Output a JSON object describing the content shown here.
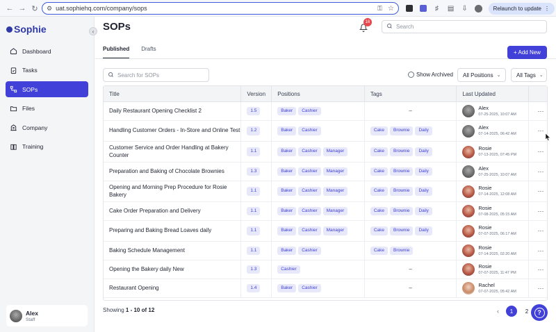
{
  "browser": {
    "url": "uat.sophiehq.com/company/sops",
    "relaunch_label": "Relaunch to update"
  },
  "brand": {
    "name": "Sophie",
    "accent": "#4140d8"
  },
  "sidebar": {
    "items": [
      {
        "label": "Dashboard",
        "icon": "home-icon",
        "active": false
      },
      {
        "label": "Tasks",
        "icon": "clipboard-check-icon",
        "active": false
      },
      {
        "label": "SOPs",
        "icon": "flow-icon",
        "active": true
      },
      {
        "label": "Files",
        "icon": "folder-icon",
        "active": false
      },
      {
        "label": "Company",
        "icon": "building-icon",
        "active": false
      },
      {
        "label": "Training",
        "icon": "book-icon",
        "active": false
      }
    ],
    "user": {
      "name": "Alex",
      "role": "Staff"
    }
  },
  "header": {
    "title": "SOPs",
    "notification_count": "16",
    "search_placeholder": "Search"
  },
  "tabs": [
    {
      "label": "Published",
      "active": true
    },
    {
      "label": "Drafts",
      "active": false
    }
  ],
  "toolbar": {
    "add_new_label": "+ Add New",
    "search_placeholder": "Search for SOPs",
    "show_archived_label": "Show Archived",
    "positions_filter": "All Positions",
    "tags_filter": "All Tags"
  },
  "table": {
    "columns": [
      "Title",
      "Version",
      "Positions",
      "Tags",
      "Last Updated"
    ],
    "rows": [
      {
        "title": "Daily Restaurant Opening Checklist 2",
        "version": "1.5",
        "positions": [
          "Baker",
          "Cashier"
        ],
        "tags": [],
        "user": "Alex",
        "date": "07-25-2025, 10:07 AM",
        "avatar": "alex"
      },
      {
        "title": "Handling Customer Orders - In-Store and Online Test",
        "version": "1.2",
        "positions": [
          "Baker",
          "Cashier"
        ],
        "tags": [
          "Cake",
          "Brownie",
          "Daily"
        ],
        "user": "Alex",
        "date": "07-14-2025, 06:42 AM",
        "avatar": "alex"
      },
      {
        "title": "Customer Service and Order Handling at Bakery Counter",
        "version": "1.1",
        "positions": [
          "Baker",
          "Cashier",
          "Manager"
        ],
        "tags": [
          "Cake",
          "Brownie",
          "Daily"
        ],
        "user": "Rosie",
        "date": "07-13-2025, 07:45 PM",
        "avatar": "rosie"
      },
      {
        "title": "Preparation and Baking of Chocolate Brownies",
        "version": "1.3",
        "positions": [
          "Baker",
          "Cashier",
          "Manager"
        ],
        "tags": [
          "Cake",
          "Brownie",
          "Daily"
        ],
        "user": "Alex",
        "date": "07-25-2025, 10:07 AM",
        "avatar": "alex"
      },
      {
        "title": "Opening and Morning Prep Procedure for Rosie Bakery",
        "version": "1.1",
        "positions": [
          "Baker",
          "Cashier",
          "Manager"
        ],
        "tags": [
          "Cake",
          "Brownie",
          "Daily"
        ],
        "user": "Rosie",
        "date": "07-14-2025, 12:08 AM",
        "avatar": "rosie"
      },
      {
        "title": "Cake Order Preparation and Delivery",
        "version": "1.1",
        "positions": [
          "Baker",
          "Cashier",
          "Manager"
        ],
        "tags": [
          "Cake",
          "Brownie",
          "Daily"
        ],
        "user": "Rosie",
        "date": "07-08-2025, 05:15 AM",
        "avatar": "rosie"
      },
      {
        "title": "Preparing and Baking Bread Loaves daily",
        "version": "1.1",
        "positions": [
          "Baker",
          "Cashier",
          "Manager"
        ],
        "tags": [
          "Cake",
          "Brownie",
          "Daily"
        ],
        "user": "Rosie",
        "date": "07-07-2025, 06:17 AM",
        "avatar": "rosie"
      },
      {
        "title": "Baking Schedule Management",
        "version": "1.1",
        "positions": [
          "Baker",
          "Cashier"
        ],
        "tags": [
          "Cake",
          "Brownie"
        ],
        "user": "Rosie",
        "date": "07-14-2025, 02:20 AM",
        "avatar": "rosie"
      },
      {
        "title": "Opening the Bakery daily New",
        "version": "1.3",
        "positions": [
          "Cashier"
        ],
        "tags": [],
        "user": "Rosie",
        "date": "07-07-2025, 11:47 PM",
        "avatar": "rosie"
      },
      {
        "title": "Restaurant Opening",
        "version": "1.4",
        "positions": [
          "Baker",
          "Cashier"
        ],
        "tags": [],
        "user": "Rachel",
        "date": "07-07-2025, 05:42 AM",
        "avatar": "rachel"
      }
    ],
    "empty_tags": "–",
    "more_label": "···"
  },
  "footer": {
    "showing_prefix": "Showing ",
    "showing_range": "1 - 10 of 12",
    "pages": [
      "1",
      "2"
    ],
    "current_page": "1"
  }
}
